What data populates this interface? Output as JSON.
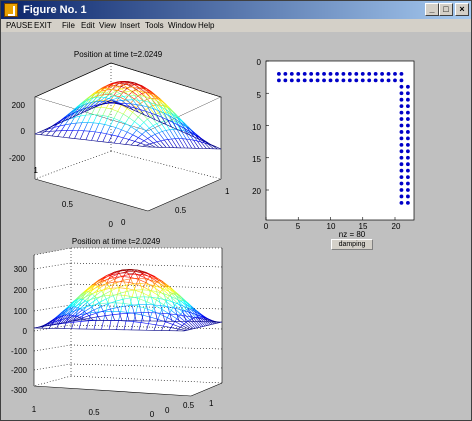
{
  "window": {
    "title": "Figure No. 1"
  },
  "window_buttons": {
    "minimize": "_",
    "maximize": "□",
    "close": "×"
  },
  "menubar": {
    "items": [
      "PAUSE",
      "EXIT",
      "File",
      "Edit",
      "View",
      "Insert",
      "Tools",
      "Window",
      "Help"
    ]
  },
  "plot_top": {
    "title": "Position at time t=2.0249",
    "z_ticks": [
      "200",
      "0",
      "-200"
    ],
    "x_ticks": [
      "1",
      "0.5",
      "0"
    ],
    "y_ticks": [
      "0",
      "0.5",
      "1"
    ]
  },
  "plot_bottom": {
    "title": "Position at time t=2.0249",
    "z_ticks": [
      "300",
      "200",
      "100",
      "0",
      "-100",
      "-200",
      "-300"
    ],
    "x_ticks": [
      "1",
      "0.5",
      "0"
    ],
    "y_ticks": [
      "0",
      "0.5",
      "1"
    ]
  },
  "spy": {
    "y_ticks": [
      "0",
      "5",
      "10",
      "15",
      "20"
    ],
    "x_ticks": [
      "0",
      "5",
      "10",
      "15",
      "20"
    ],
    "xlabel": "nz = 80",
    "button": "damping"
  },
  "colors": {
    "dots": "#0000c8",
    "titlebar": "#0a246a"
  }
}
